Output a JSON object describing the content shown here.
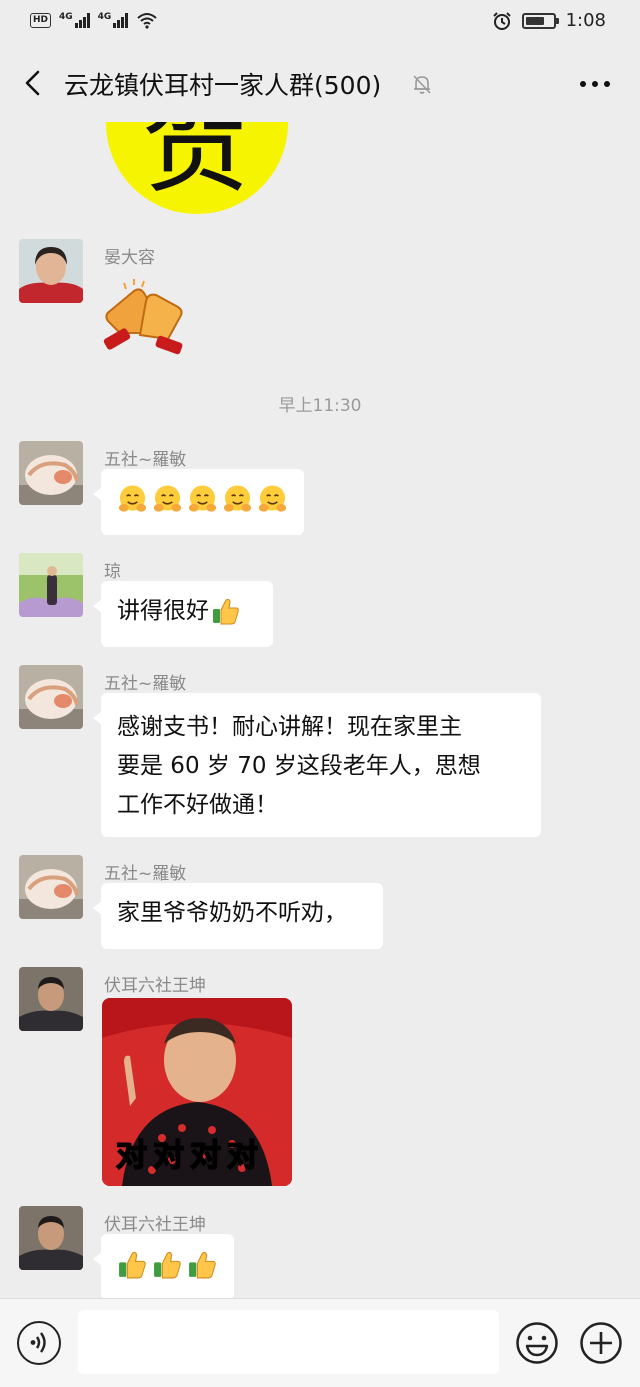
{
  "status_bar": {
    "hd_label": "HD",
    "network_1": "4G",
    "network_2": "4G",
    "time": "1:08",
    "battery_level": 0.7
  },
  "header": {
    "title": "云龙镇伏耳村一家人群(500)"
  },
  "chat": {
    "sticker_char": "贺",
    "messages": [
      {
        "sender": "晏大容",
        "type": "emoji",
        "content": "clapping-hands-emoji"
      },
      {
        "sender": "五社~羅敏",
        "type": "emoji",
        "content": "hugging-face-emoji x5"
      },
      {
        "sender": "琼",
        "type": "text",
        "text": "讲得很好"
      },
      {
        "sender": "五社~羅敏",
        "type": "text",
        "lines": [
          "感谢支书！耐心讲解！现在家里主",
          "要是 60 岁  70 岁这段老年人，思想",
          "工作不好做通！"
        ]
      },
      {
        "sender": "五社~羅敏",
        "type": "text",
        "text": "家里爷爷奶奶不听劝，"
      },
      {
        "sender": "伏耳六社王坤",
        "type": "sticker",
        "caption": "对对对对"
      },
      {
        "sender": "伏耳六社王坤",
        "type": "emoji",
        "content": "thumbs-up-emoji x3"
      }
    ],
    "timestamp": "早上11:30"
  },
  "colors": {
    "background": "#ededed",
    "bubble": "#ffffff",
    "sticker_yellow": "#f7f400",
    "sticker_red": "#c81c1c"
  }
}
